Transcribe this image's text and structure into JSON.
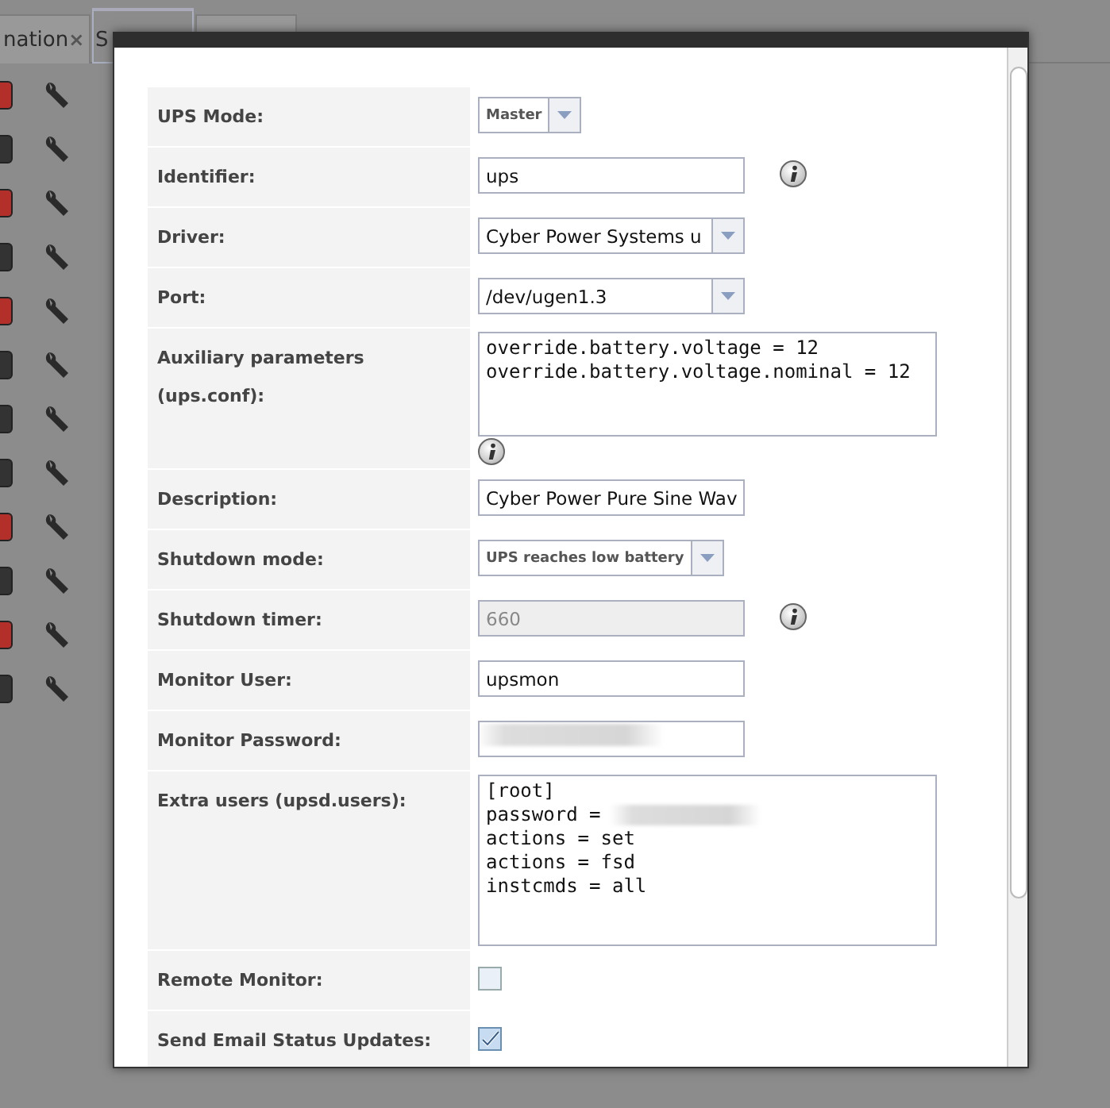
{
  "background_tabs": [
    {
      "label": "nation",
      "close": "×",
      "selected": false
    },
    {
      "label": "S",
      "selected": true
    },
    {
      "selected": false
    }
  ],
  "background_rows": [
    {
      "on": true
    },
    {
      "on": false
    },
    {
      "on": true
    },
    {
      "on": false
    },
    {
      "on": true
    },
    {
      "on": false
    },
    {
      "on": false
    },
    {
      "on": false
    },
    {
      "on": true
    },
    {
      "on": false
    },
    {
      "on": true
    },
    {
      "on": false
    }
  ],
  "form": [
    {
      "label": "UPS Mode:",
      "kind": "compact_select",
      "value": "Master"
    },
    {
      "label": "Identifier:",
      "kind": "text",
      "value": "ups",
      "info": true
    },
    {
      "label": "Driver:",
      "kind": "select",
      "value": "Cyber Power Systems u"
    },
    {
      "label": "Port:",
      "kind": "select",
      "value": "/dev/ugen1.3"
    },
    {
      "label": "Auxiliary parameters (ups.conf):",
      "kind": "textarea",
      "lines": [
        {
          "text": "override.battery.voltage = 12"
        },
        {
          "text": "override.battery.voltage.nominal = 12"
        }
      ],
      "info_below": true
    },
    {
      "label": "Description:",
      "kind": "text",
      "value": "Cyber Power Pure Sine Wav"
    },
    {
      "label": "Shutdown mode:",
      "kind": "compact_select",
      "value": "UPS reaches low battery"
    },
    {
      "label": "Shutdown timer:",
      "kind": "text",
      "value": "660",
      "disabled": true,
      "info": true
    },
    {
      "label": "Monitor User:",
      "kind": "text",
      "value": "upsmon"
    },
    {
      "label": "Monitor Password:",
      "kind": "text",
      "redacted": true
    },
    {
      "label": "Extra users (upsd.users):",
      "kind": "textarea",
      "tall": true,
      "lines": [
        {
          "text": "[root]"
        },
        {
          "text": "password =",
          "redacted": true
        },
        {
          "text": "actions = set"
        },
        {
          "text": "actions = fsd"
        },
        {
          "text": "instcmds = all"
        }
      ]
    },
    {
      "label": "Remote Monitor:",
      "kind": "checkbox",
      "checked": false
    },
    {
      "label": "Send Email Status Updates:",
      "kind": "checkbox",
      "checked": true
    }
  ]
}
